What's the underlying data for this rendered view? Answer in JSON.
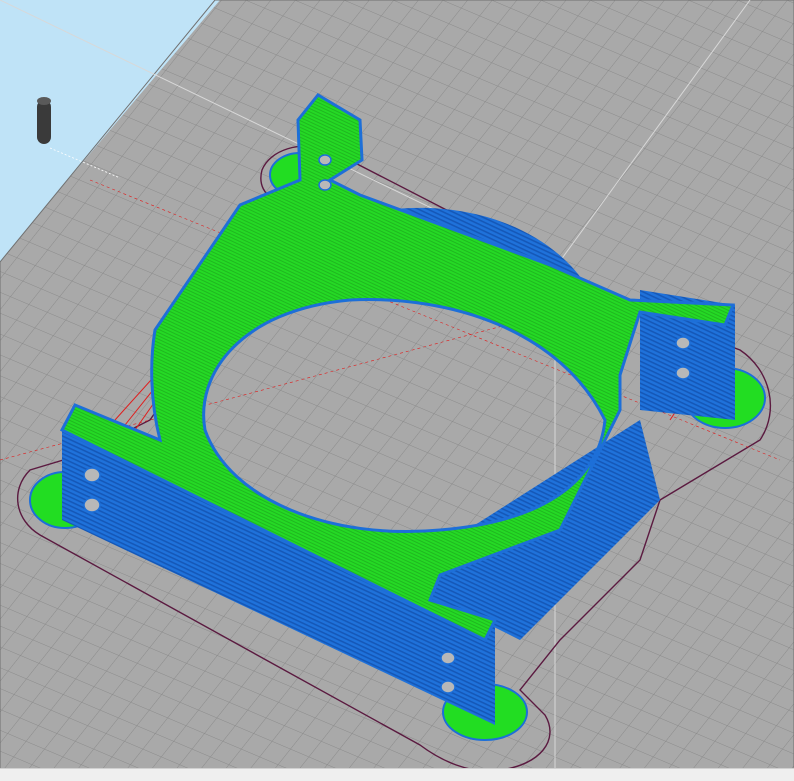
{
  "app": {
    "view": "3d-slicer-preview",
    "object": "motor-mount-bracket",
    "visible_text": []
  },
  "scene": {
    "background_color": "#bfe3f7",
    "bed_color": "#a9a9a9",
    "grid_line_color": "#8c8c8c",
    "grid_major_color": "#7a7a7a",
    "perimeter_color": "#1d6fd8",
    "top_infill_color": "#22dd22",
    "support_color": "#e01c1c",
    "skirt_color": "#6a1a4a",
    "indicator_icon": "cylinder-nozzle-icon"
  }
}
